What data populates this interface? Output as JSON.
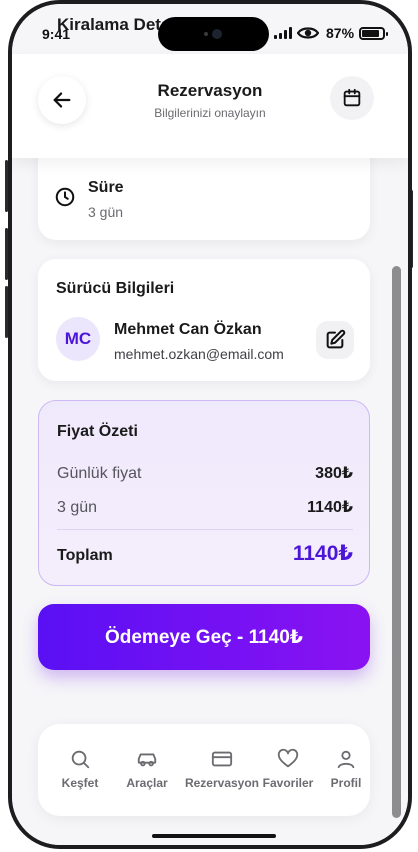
{
  "status_bar": {
    "time": "9:41",
    "battery_percent": "87%"
  },
  "behind_title": "Kiralama Deta",
  "header": {
    "title": "Rezervasyon",
    "subtitle": "Bilgilerinizi onaylayın"
  },
  "duration": {
    "label": "Süre",
    "value": "3 gün"
  },
  "driver": {
    "section_title": "Sürücü Bilgileri",
    "initials": "MC",
    "name": "Mehmet Can Özkan",
    "email": "mehmet.ozkan@email.com"
  },
  "price_summary": {
    "section_title": "Fiyat Özeti",
    "rows": [
      {
        "label": "Günlük fiyat",
        "value": "380₺"
      },
      {
        "label": "3 gün",
        "value": "1140₺"
      }
    ],
    "total_label": "Toplam",
    "total_value": "1140₺"
  },
  "pay_button": {
    "label": "Ödemeye Geç - 1140₺"
  },
  "tabs": [
    {
      "label": "Keşfet",
      "icon": "search-icon"
    },
    {
      "label": "Araçlar",
      "icon": "car-icon"
    },
    {
      "label": "Rezervasyon",
      "icon": "credit-card-icon"
    },
    {
      "label": "Favoriler",
      "icon": "heart-icon"
    },
    {
      "label": "Profil",
      "icon": "user-icon"
    }
  ],
  "colors": {
    "accent": "#4c16d8",
    "button_gradient_start": "#5a10f4",
    "button_gradient_end": "#8a12f2",
    "price_card_bg": "#efe9fc",
    "price_card_border": "#cbb8f5"
  }
}
